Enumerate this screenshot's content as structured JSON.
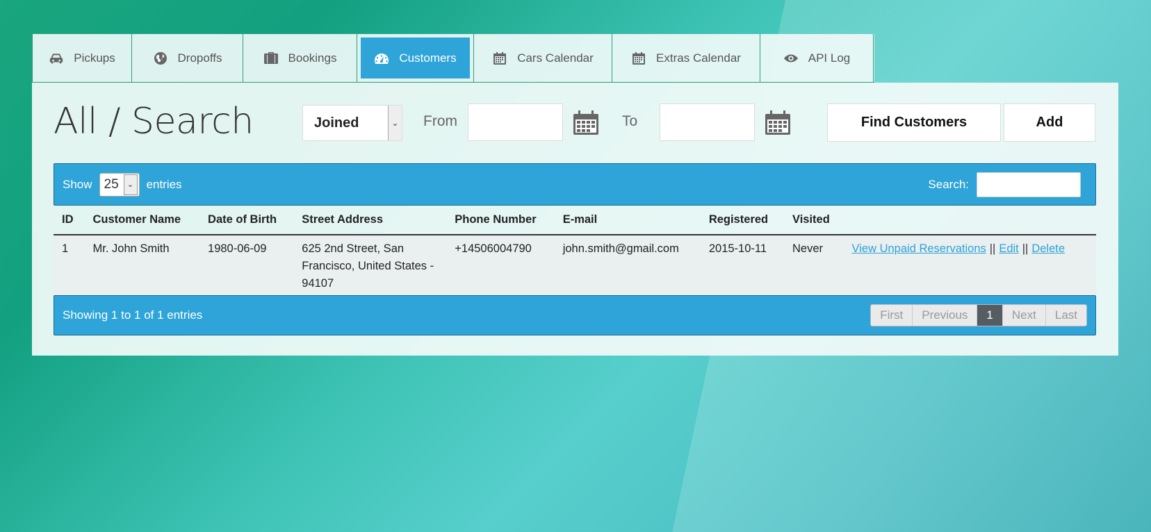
{
  "tabs": [
    {
      "label": "Pickups",
      "icon": "car-icon"
    },
    {
      "label": "Dropoffs",
      "icon": "globe-icon"
    },
    {
      "label": "Bookings",
      "icon": "suitcase-icon"
    },
    {
      "label": "Customers",
      "icon": "dashboard-icon",
      "active": true
    },
    {
      "label": "Cars Calendar",
      "icon": "calendar-icon"
    },
    {
      "label": "Extras Calendar",
      "icon": "calendar-icon"
    },
    {
      "label": "API Log",
      "icon": "eye-icon"
    }
  ],
  "toolbar": {
    "title": "All / Search",
    "filter_select": "Joined",
    "from_label": "From",
    "to_label": "To",
    "from_value": "",
    "to_value": "",
    "find_button": "Find Customers",
    "add_button": "Add"
  },
  "table_controls": {
    "show_label": "Show",
    "length_value": "25",
    "entries_label": "entries",
    "search_label": "Search:",
    "search_value": ""
  },
  "columns": [
    "ID",
    "Customer Name",
    "Date of Birth",
    "Street Address",
    "Phone Number",
    "E-mail",
    "Registered",
    "Visited"
  ],
  "rows": [
    {
      "id": "1",
      "name": "Mr. John Smith",
      "dob": "1980-06-09",
      "address": "625 2nd Street, San Francisco, United States - 94107",
      "phone": "+14506004790",
      "email": "john.smith@gmail.com",
      "registered": "2015-10-11",
      "visited": "Never",
      "actions": {
        "view": "View Unpaid Reservations",
        "sep": "||",
        "edit": "Edit",
        "delete": "Delete"
      }
    }
  ],
  "footer": {
    "info": "Showing 1 to 1 of 1 entries",
    "pagination": {
      "first": "First",
      "previous": "Previous",
      "current": "1",
      "next": "Next",
      "last": "Last"
    }
  },
  "colors": {
    "accent": "#2ea4d8",
    "page_current": "#555d63"
  }
}
